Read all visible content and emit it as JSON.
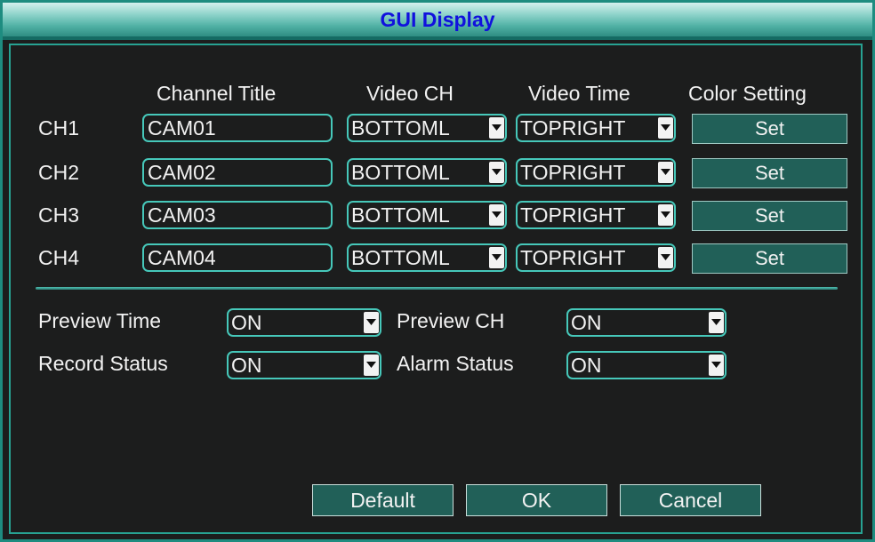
{
  "window": {
    "title": "GUI Display"
  },
  "headers": [
    "Channel Title",
    "Video CH",
    "Video Time",
    "Color Setting"
  ],
  "channels": [
    {
      "label": "CH1",
      "title": "CAM01",
      "video_ch": "BOTTOML",
      "video_time": "TOPRIGHT",
      "color": "Set"
    },
    {
      "label": "CH2",
      "title": "CAM02",
      "video_ch": "BOTTOML",
      "video_time": "TOPRIGHT",
      "color": "Set"
    },
    {
      "label": "CH3",
      "title": "CAM03",
      "video_ch": "BOTTOML",
      "video_time": "TOPRIGHT",
      "color": "Set"
    },
    {
      "label": "CH4",
      "title": "CAM04",
      "video_ch": "BOTTOML",
      "video_time": "TOPRIGHT",
      "color": "Set"
    }
  ],
  "options": {
    "preview_time": {
      "label": "Preview Time",
      "value": "ON"
    },
    "preview_ch": {
      "label": "Preview CH",
      "value": "ON"
    },
    "record_status": {
      "label": "Record Status",
      "value": "ON"
    },
    "alarm_status": {
      "label": "Alarm Status",
      "value": "ON"
    }
  },
  "buttons": {
    "default": "Default",
    "ok": "OK",
    "cancel": "Cancel"
  },
  "icons": {
    "dropdown": "chevron-down-icon"
  },
  "colors": {
    "accent": "#46c8ba",
    "title_text": "#1111dd",
    "button_bg": "#216058"
  }
}
